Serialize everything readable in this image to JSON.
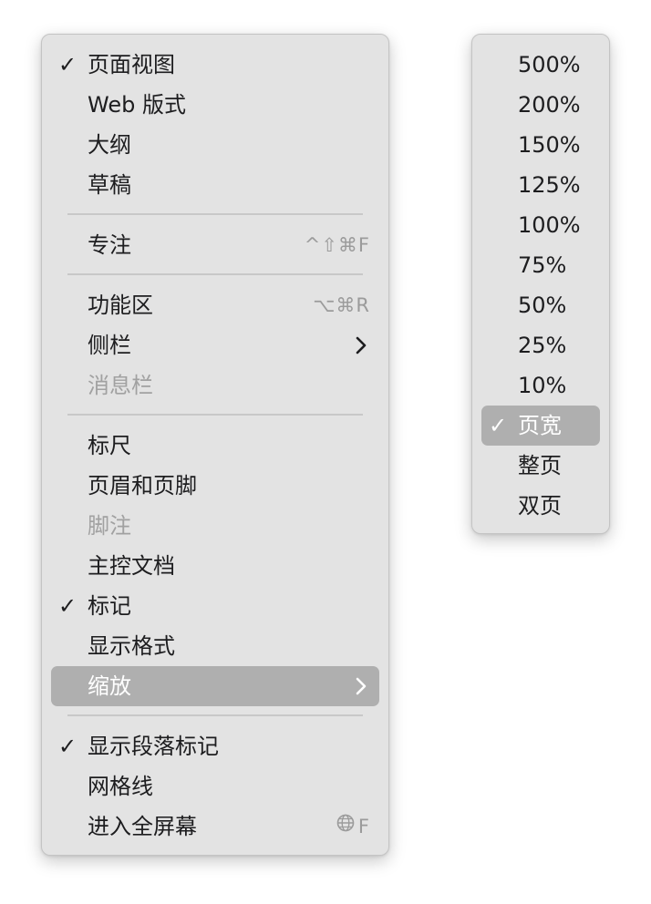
{
  "view_menu": {
    "sections": [
      {
        "items": [
          {
            "label": "页面视图",
            "checked": true
          },
          {
            "label": "Web 版式"
          },
          {
            "label": "大纲"
          },
          {
            "label": "草稿"
          }
        ]
      },
      {
        "items": [
          {
            "label": "专注",
            "shortcut": "^⇧⌘F"
          }
        ]
      },
      {
        "items": [
          {
            "label": "功能区",
            "shortcut": "⌥⌘R"
          },
          {
            "label": "侧栏",
            "submenu": true
          },
          {
            "label": "消息栏",
            "disabled": true
          }
        ]
      },
      {
        "items": [
          {
            "label": "标尺"
          },
          {
            "label": "页眉和页脚"
          },
          {
            "label": "脚注",
            "disabled": true
          },
          {
            "label": "主控文档"
          },
          {
            "label": "标记",
            "checked": true
          },
          {
            "label": "显示格式"
          },
          {
            "label": "缩放",
            "submenu": true,
            "highlighted": true
          }
        ]
      },
      {
        "items": [
          {
            "label": "显示段落标记",
            "checked": true
          },
          {
            "label": "网格线"
          },
          {
            "label": "进入全屏幕",
            "shortcut_icon": "globe-icon",
            "shortcut": "F"
          }
        ]
      }
    ]
  },
  "zoom_menu": {
    "items": [
      {
        "label": "500%"
      },
      {
        "label": "200%"
      },
      {
        "label": "150%"
      },
      {
        "label": "125%"
      },
      {
        "label": "100%"
      },
      {
        "label": "75%"
      },
      {
        "label": "50%"
      },
      {
        "label": "25%"
      },
      {
        "label": "10%"
      },
      {
        "label": "页宽",
        "checked": true,
        "highlighted": true
      },
      {
        "label": "整页"
      },
      {
        "label": "双页"
      }
    ]
  },
  "icons": {
    "check": "✓",
    "chevron": "chevron-right-icon",
    "globe": "globe-icon"
  },
  "colors": {
    "menu_bg": "#e3e3e3",
    "highlight": "#afafaf",
    "text": "#1d1d1f",
    "disabled_text": "#a1a1a1",
    "shortcut_text": "#9b9b9b"
  }
}
